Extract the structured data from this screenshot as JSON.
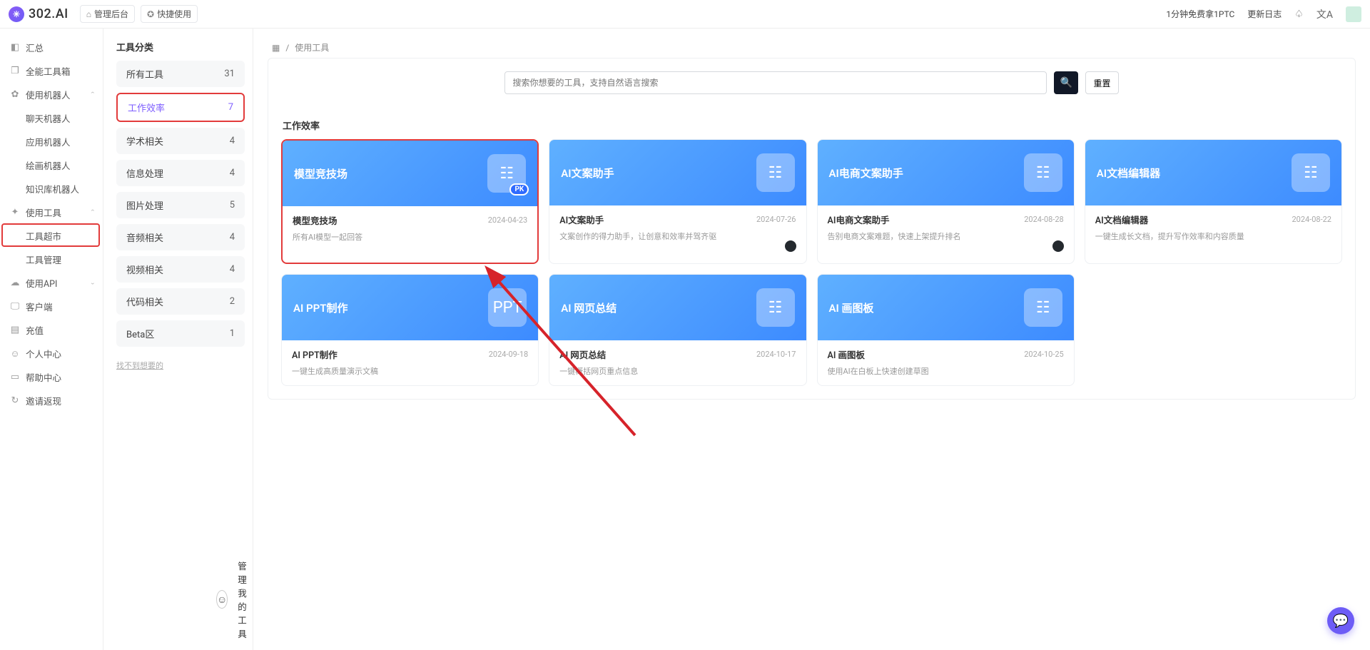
{
  "brand": {
    "text": "302.AI"
  },
  "topbar": {
    "pill1": "管理后台",
    "pill2": "快捷使用",
    "promo": "1分钟免费拿1PTC",
    "changelog": "更新日志"
  },
  "sidebar": {
    "items": [
      {
        "label": "汇总",
        "icon": "◧"
      },
      {
        "label": "全能工具箱",
        "icon": "❐"
      },
      {
        "label": "使用机器人",
        "icon": "✿",
        "state": "exp"
      },
      {
        "label": "聊天机器人",
        "sub": true
      },
      {
        "label": "应用机器人",
        "sub": true
      },
      {
        "label": "绘画机器人",
        "sub": true
      },
      {
        "label": "知识库机器人",
        "sub": true
      },
      {
        "label": "使用工具",
        "icon": "✦",
        "state": "exp"
      },
      {
        "label": "工具超市",
        "sub": true,
        "hl": true
      },
      {
        "label": "工具管理",
        "sub": true
      },
      {
        "label": "使用API",
        "icon": "☁",
        "state": "col"
      },
      {
        "label": "客户端",
        "icon": "🖵"
      },
      {
        "label": "充值",
        "icon": "▤"
      },
      {
        "label": "个人中心",
        "icon": "☺"
      },
      {
        "label": "帮助中心",
        "icon": "▭"
      },
      {
        "label": "邀请返现",
        "icon": "↻"
      }
    ]
  },
  "crumbs": {
    "icon": "▦",
    "sep": "/",
    "current": "使用工具"
  },
  "catpanel": {
    "title": "工具分类",
    "items": [
      {
        "label": "所有工具",
        "count": 31
      },
      {
        "label": "工作效率",
        "count": 7,
        "active": true
      },
      {
        "label": "学术相关",
        "count": 4
      },
      {
        "label": "信息处理",
        "count": 4
      },
      {
        "label": "图片处理",
        "count": 5
      },
      {
        "label": "音频相关",
        "count": 4
      },
      {
        "label": "视频相关",
        "count": 4
      },
      {
        "label": "代码相关",
        "count": 2
      },
      {
        "label": "Beta区",
        "count": 1
      }
    ],
    "not_found": "找不到想要的",
    "manage": "管理我的工具"
  },
  "search": {
    "placeholder": "搜索你想要的工具，支持自然语言搜索",
    "reset": "重置"
  },
  "section": {
    "title": "工作效率"
  },
  "cards": [
    {
      "header": "模型竞技场",
      "name": "模型竞技场",
      "desc": "所有AI模型一起回答",
      "date": "2024-04-23",
      "iconText": "",
      "pk": true,
      "highlight": true
    },
    {
      "header": "AI文案助手",
      "name": "AI文案助手",
      "desc": "文案创作的得力助手，让创意和效率并驾齐驱",
      "date": "2024-07-26",
      "github": true
    },
    {
      "header": "AI电商文案助手",
      "name": "AI电商文案助手",
      "desc": "告别电商文案难题，快速上架提升排名",
      "date": "2024-08-28",
      "github": true
    },
    {
      "header": "AI文档编辑器",
      "name": "AI文档编辑器",
      "desc": "一键生成长文档，提升写作效率和内容质量",
      "date": "2024-08-22"
    },
    {
      "header": "AI PPT制作",
      "name": "AI PPT制作",
      "desc": "一键生成高质量演示文稿",
      "date": "2024-09-18",
      "ppt": true
    },
    {
      "header": "AI 网页总结",
      "name": "AI 网页总结",
      "desc": "一键概括网页重点信息",
      "date": "2024-10-17"
    },
    {
      "header": "AI 画图板",
      "name": "AI 画图板",
      "desc": "使用AI在白板上快速创建草图",
      "date": "2024-10-25"
    }
  ]
}
